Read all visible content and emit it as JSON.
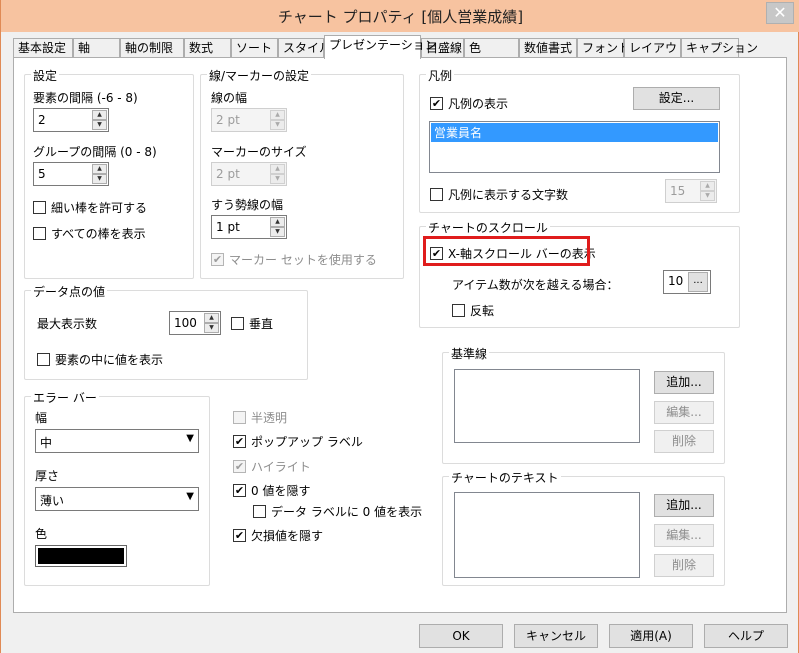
{
  "window": {
    "title": "チャート プロパティ [個人営業成績]",
    "close_glyph": "✕"
  },
  "tabs": [
    {
      "label": "基本設定"
    },
    {
      "label": "軸"
    },
    {
      "label": "軸の制限"
    },
    {
      "label": "数式"
    },
    {
      "label": "ソート"
    },
    {
      "label": "スタイル"
    },
    {
      "label": "プレゼンテーション"
    },
    {
      "label": "目盛線"
    },
    {
      "label": "色"
    },
    {
      "label": "数値書式"
    },
    {
      "label": "フォント"
    },
    {
      "label": "レイアウト"
    },
    {
      "label": "キャプション"
    }
  ],
  "settings": {
    "legend": "設定",
    "bar_spacing_label": "要素の間隔 (-6 - 8)",
    "bar_spacing_value": "2",
    "group_spacing_label": "グループの間隔 (0 - 8)",
    "group_spacing_value": "5",
    "allow_thin_bars": "細い棒を許可する",
    "show_all_bars": "すべての棒を表示"
  },
  "line_marker": {
    "legend": "線/マーカーの設定",
    "line_width_label": "線の幅",
    "line_width_value": "2 pt",
    "marker_size_label": "マーカーのサイズ",
    "marker_size_value": "2 pt",
    "trend_width_label": "すう勢線の幅",
    "trend_width_value": "1 pt",
    "use_marker_set": "マーカー セットを使用する"
  },
  "data_values": {
    "legend": "データ点の値",
    "max_label": "最大表示数",
    "max_value": "100",
    "vertical": "垂直",
    "inside": "要素の中に値を表示"
  },
  "error_bars": {
    "legend": "エラー バー",
    "width_label": "幅",
    "width_value": "中",
    "thickness_label": "厚さ",
    "thickness_value": "薄い",
    "color_label": "色",
    "color_swatch": "#000000"
  },
  "misc_options": {
    "semi_transparent": "半透明",
    "popup_labels": "ポップアップ ラベル",
    "highlight": "ハイライト",
    "hide_zero": "0 値を隠す",
    "show_zero_on_labels": "データ ラベルに 0 値を表示",
    "hide_missing": "欠損値を隠す"
  },
  "legend_group": {
    "legend": "凡例",
    "show_legend": "凡例の表示",
    "settings_button": "設定...",
    "list_items": [
      "営業員名"
    ],
    "limit_chars": "凡例に表示する文字数",
    "limit_value": "15"
  },
  "scroll": {
    "legend": "チャートのスクロール",
    "show_x_scrollbar": "X-軸スクロール バーの表示",
    "items_exceed_label": "アイテム数が次を越える場合：",
    "items_exceed_value": "10",
    "ellipsis_button": "...",
    "reverse": "反転"
  },
  "reference_lines": {
    "legend": "基準線",
    "add": "追加...",
    "edit": "編集...",
    "delete": "削除"
  },
  "chart_text": {
    "legend": "チャートのテキスト",
    "add": "追加...",
    "edit": "編集...",
    "delete": "削除"
  },
  "footer": {
    "ok": "OK",
    "cancel": "キャンセル",
    "apply": "適用(A)",
    "help": "ヘルプ"
  },
  "colors": {
    "highlight_border": "#e01c1c",
    "selected_list_item": "#3399ff"
  }
}
